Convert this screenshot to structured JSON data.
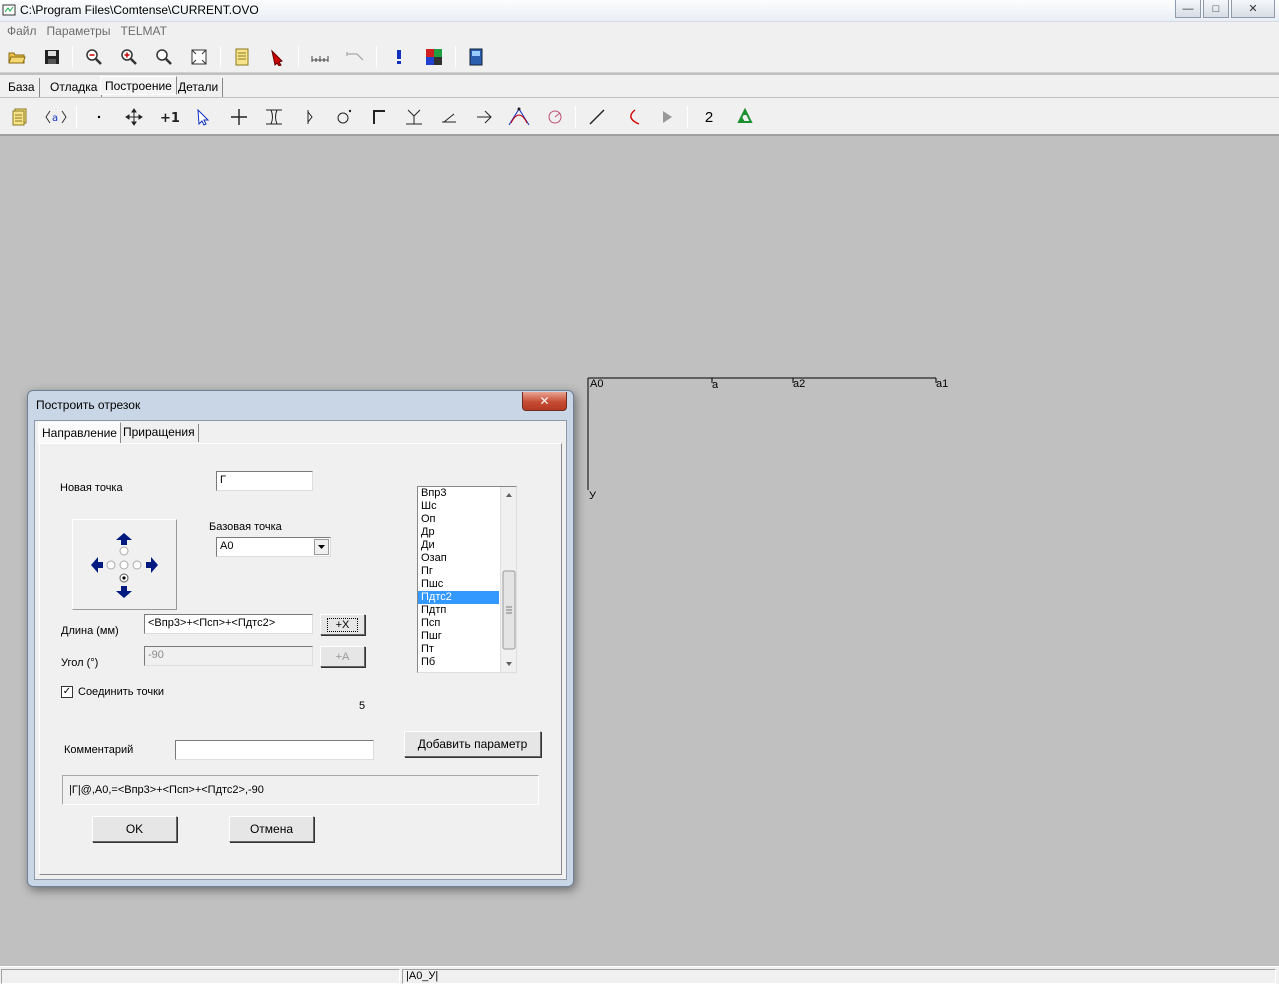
{
  "window": {
    "title": "C:\\Program Files\\Comtense\\CURRENT.OVO",
    "controls": {
      "minimize": "—",
      "maximize": "□",
      "close": "✕"
    }
  },
  "menu": [
    "Файл",
    "Параметры",
    "TELMAT"
  ],
  "toolbar1": {
    "icons": [
      "open-icon",
      "save-icon",
      "zoom-out-icon",
      "zoom-in-icon",
      "zoom-icon",
      "fit-page-icon",
      "document-icon",
      "pointer-icon",
      "measure-icon",
      "angle-measure-icon",
      "exclamation-icon",
      "palette-icon",
      "book-icon"
    ]
  },
  "main_tabs": [
    "База",
    "Отладка",
    "Построение",
    "Детали"
  ],
  "active_main_tab": "Построение",
  "toolbar2": {
    "icons": [
      "notes-icon",
      "variable-icon",
      "point-icon",
      "move-icon",
      "plus-one-icon",
      "select-icon",
      "cross-icon",
      "intersection-icon",
      "bisect-icon",
      "circle-point-icon",
      "corner-icon",
      "perpendicular-icon",
      "angle-icon",
      "arrow-icon",
      "curve-icon",
      "arc-icon",
      "line-icon",
      "curve-line-icon",
      "play-icon",
      "recycle-icon"
    ],
    "number_button": "2"
  },
  "canvas": {
    "point_labels": [
      "A0",
      "a",
      "a2",
      "a1",
      "У"
    ]
  },
  "status": {
    "pane2": "|A0_У|"
  },
  "dialog": {
    "title": "Построить отрезок",
    "close_label": "✕",
    "tabs": [
      "Направление",
      "Приращения"
    ],
    "active_tab": "Направление",
    "new_point_label": "Новая точка",
    "new_point_value": "Г",
    "base_point_label": "Базовая точка",
    "base_point_value": "A0",
    "length_label": "Длина (мм)",
    "length_value": "<Впр3>+<Псп>+<Пдтс2>",
    "length_button": "+X",
    "angle_label": "Угол (°)",
    "angle_value": "-90",
    "angle_button": "+A",
    "connect_label": "Соединить точки",
    "connect_checked": "✓",
    "count": "5",
    "comment_label": "Комментарий",
    "comment_value": "",
    "add_param_button": "Добавить параметр",
    "formula": "|Г|@,A0,=<Впр3>+<Псп>+<Пдтс2>,-90",
    "ok_button": "OK",
    "cancel_button": "Отмена",
    "param_list": [
      "Впр3",
      "Шс",
      "Оп",
      "Др",
      "Ди",
      "Озап",
      "Пг",
      "Пшс",
      "Пдтс2",
      "Пдтп",
      "Псп",
      "Пшг",
      "Пт",
      "Пб"
    ],
    "param_list_selected": "Пдтс2"
  }
}
